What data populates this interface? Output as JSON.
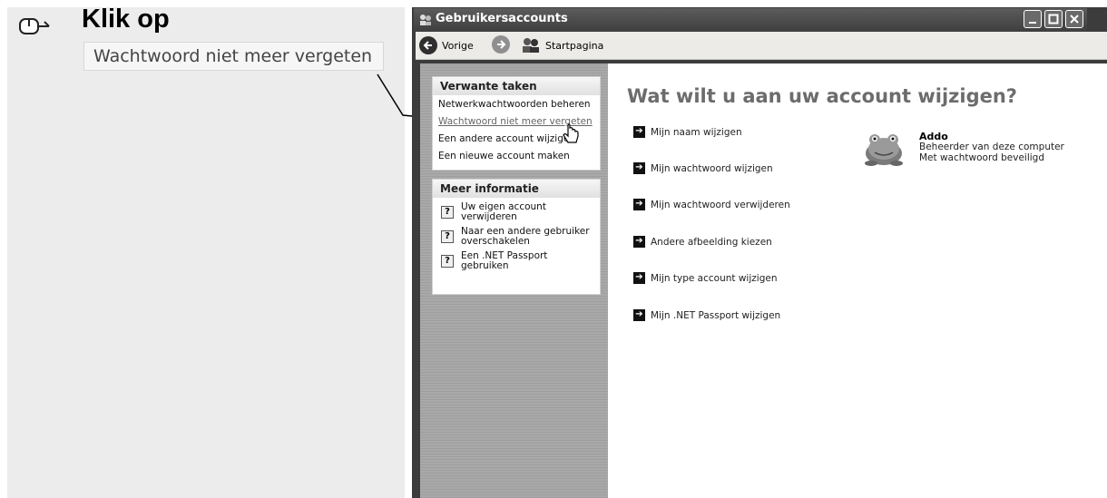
{
  "instruction": {
    "text": "Klik op",
    "target_label": "Wachtwoord niet meer vergeten"
  },
  "window": {
    "title": "Gebruikersaccounts",
    "toolbar": {
      "back_label": "Vorige",
      "home_label": "Startpagina"
    }
  },
  "sidebar": {
    "tasks_header": "Verwante taken",
    "tasks": [
      "Netwerkwachtwoorden beheren",
      "Wachtwoord niet meer vergeten",
      "Een andere account wijzigen",
      "Een nieuwe account maken"
    ],
    "info_header": "Meer informatie",
    "info": [
      "Uw eigen account verwijderen",
      "Naar een andere gebruiker overschakelen",
      "Een .NET Passport gebruiken"
    ]
  },
  "main": {
    "headline": "Wat wilt u aan uw account wijzigen?",
    "actions": [
      "Mijn naam wijzigen",
      "Mijn wachtwoord wijzigen",
      "Mijn wachtwoord verwijderen",
      "Andere afbeelding kiezen",
      "Mijn type account wijzigen",
      "Mijn .NET Passport wijzigen"
    ],
    "user": {
      "name": "Addo",
      "role": "Beheerder van deze computer",
      "status": "Met wachtwoord beveiligd"
    }
  },
  "icons": {
    "instruction": "mouse-pointer-icon",
    "back": "back-arrow-icon",
    "forward": "forward-arrow-icon",
    "home": "users-icon",
    "action": "arrow-right-icon",
    "help": "help-icon",
    "avatar": "frog-avatar",
    "cursor": "hand-cursor-icon"
  }
}
